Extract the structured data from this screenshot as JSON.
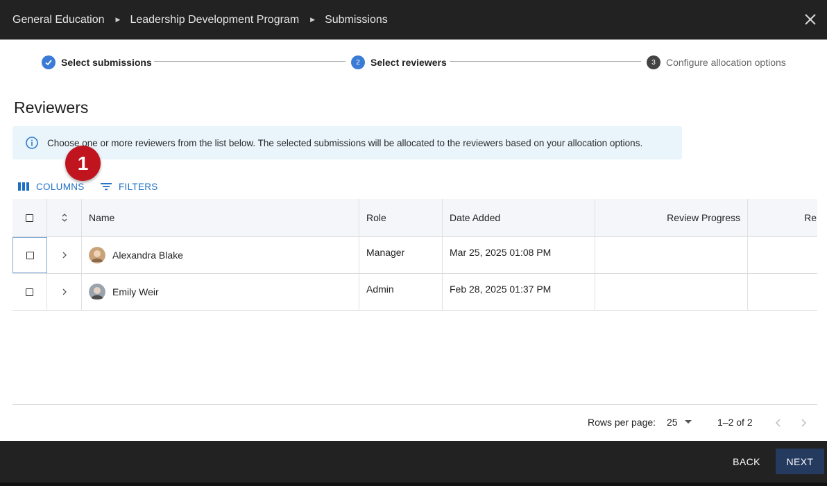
{
  "breadcrumb": [
    "General Education",
    "Leadership Development Program",
    "Submissions"
  ],
  "stepper": {
    "steps": [
      {
        "number": "1",
        "label": "Select submissions",
        "state": "completed"
      },
      {
        "number": "2",
        "label": "Select reviewers",
        "state": "active"
      },
      {
        "number": "3",
        "label": "Configure allocation options",
        "state": "pending"
      }
    ]
  },
  "section_title": "Reviewers",
  "info_message": "Choose one or more reviewers from the list below. The selected submissions will be allocated to the reviewers based on your allocation options.",
  "annotation_badge": "1",
  "toolbar": {
    "columns_label": "COLUMNS",
    "filters_label": "FILTERS"
  },
  "table": {
    "headers": [
      "Name",
      "Role",
      "Date Added",
      "Review Progress",
      "Re"
    ],
    "rows": [
      {
        "name": "Alexandra Blake",
        "role": "Manager",
        "date_added": "Mar 25, 2025 01:08 PM",
        "review_progress": ""
      },
      {
        "name": "Emily Weir",
        "role": "Admin",
        "date_added": "Feb 28, 2025 01:37 PM",
        "review_progress": ""
      }
    ]
  },
  "pagination": {
    "rows_per_page_label": "Rows per page:",
    "rows_per_page_value": "25",
    "range": "1–2 of 2"
  },
  "actions": {
    "back_label": "BACK",
    "next_label": "NEXT"
  },
  "colors": {
    "header_bg": "#222222",
    "accent": "#1e6fc4",
    "step_active": "#3a7bd5",
    "info_bg": "#e9f4fb",
    "badge": "#c0141f",
    "next_btn": "#243a5e"
  }
}
